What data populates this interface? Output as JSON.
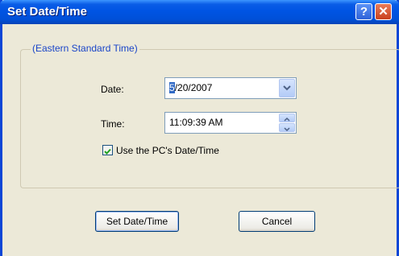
{
  "window": {
    "title": "Set Date/Time",
    "help_label": "?",
    "close_label": "✕"
  },
  "group": {
    "legend": "(Eastern Standard Time)"
  },
  "date": {
    "label": "Date:",
    "value_selected": "5",
    "value_rest": "/20/2007"
  },
  "time": {
    "label": "Time:",
    "value": "11:09:39 AM"
  },
  "use_pc_time": {
    "label": "Use the PC's Date/Time",
    "checked": true
  },
  "buttons": {
    "set_label": "Set Date/Time",
    "cancel_label": "Cancel"
  },
  "icons": {
    "dropdown": "chevron-down-icon",
    "spin_up": "chevron-up-icon",
    "spin_down": "chevron-down-icon",
    "check": "checkmark-icon"
  },
  "colors": {
    "titlebar": "#0054e3",
    "legend_text": "#1a45c8",
    "selection": "#316ac5"
  }
}
